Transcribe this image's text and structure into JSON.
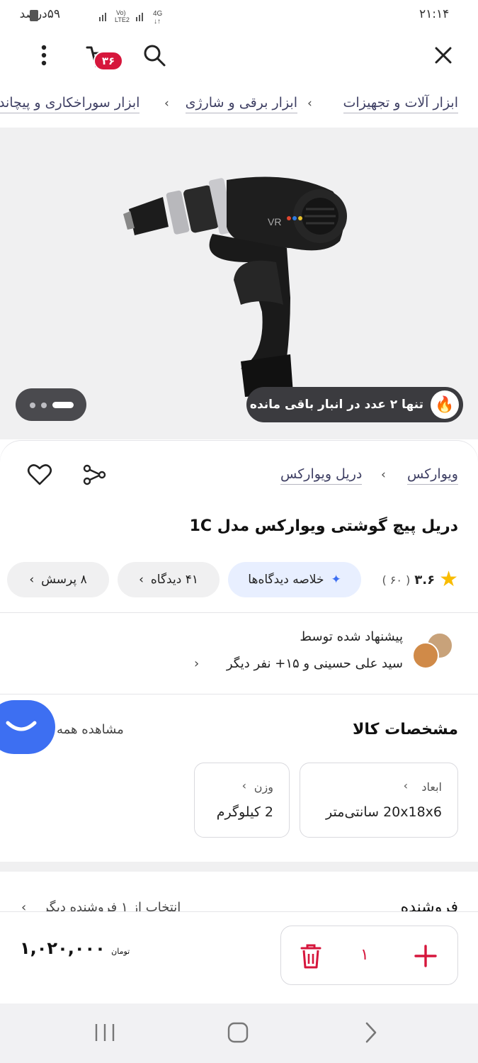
{
  "status_bar": {
    "time": "۲۱:۱۴",
    "battery": "۵۹درصد",
    "network": "4G"
  },
  "header": {
    "cart_count": "۳۶",
    "icons": [
      "close-icon",
      "search-icon",
      "cart-icon",
      "more-vertical-icon"
    ]
  },
  "breadcrumb": {
    "items": [
      "ابزار آلات و تجهیزات",
      "ابزار برقی و شارژی",
      "ابزار سوراخکاری و پیچاند"
    ]
  },
  "gallery": {
    "stock_text": "تنها ۲ عدد در انبار باقی مانده",
    "stock_icon": "🔥",
    "slide_count": 3,
    "active_slide": 1
  },
  "product": {
    "brand": "ویوارکس",
    "category": "دریل ویوارکس",
    "title": "دریل پیچ گوشتی ویوارکس مدل 1C",
    "rating": "۳.۶",
    "rating_count": "( ۶۰ )",
    "ai_summary": "خلاصه دیدگاه‌ها",
    "comments": "۴۱ دیدگاه",
    "questions": "۸ پرسش"
  },
  "recommendation": {
    "title": "پیشنهاد شده توسط",
    "by": "سید علی حسینی و ۱۵+ نفر دیگر"
  },
  "specs": {
    "title": "مشخصات کالا",
    "see_all": "مشاهده همه",
    "items": [
      {
        "label": "ابعاد",
        "value": "20x18x6 سانتی‌متر"
      },
      {
        "label": "وزن",
        "value": "2 کیلوگرم"
      }
    ]
  },
  "seller": {
    "title": "فروشنده",
    "other_sellers": "انتخاب از ۱ فروشنده دیگر"
  },
  "cart_bar": {
    "quantity": "۱",
    "price": "۱,۰۲۰,۰۰۰",
    "currency": "تومان"
  },
  "colors": {
    "accent": "#d6163c",
    "link": "#3f4064",
    "fab": "#3d6ff2"
  }
}
